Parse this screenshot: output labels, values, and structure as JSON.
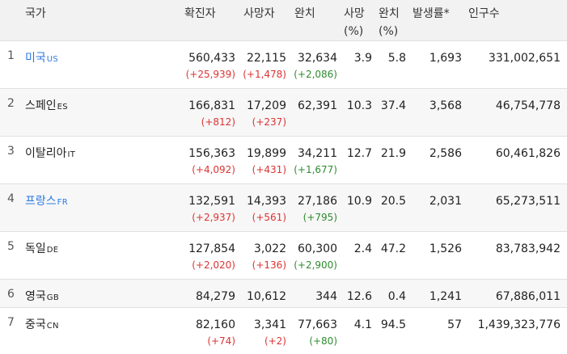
{
  "headers": {
    "country": "국가",
    "confirmed": "확진자",
    "deaths": "사망자",
    "recovered": "완치",
    "death_rate": "사망\n(%)",
    "recovery_rate": "완치\n(%)",
    "incidence": "발생률*",
    "population": "인구수"
  },
  "rows": [
    {
      "rank": "1",
      "name": "미국",
      "code": "US",
      "link": true,
      "confirmed": "560,433",
      "confirmed_delta": "(+25,939)",
      "deaths": "22,115",
      "deaths_delta": "(+1,478)",
      "recovered": "32,634",
      "recovered_delta": "(+2,086)",
      "death_rate": "3.9",
      "recovery_rate": "5.8",
      "incidence": "1,693",
      "population": "331,002,651"
    },
    {
      "rank": "2",
      "name": "스페인",
      "code": "ES",
      "link": false,
      "confirmed": "166,831",
      "confirmed_delta": "(+812)",
      "deaths": "17,209",
      "deaths_delta": "(+237)",
      "recovered": "62,391",
      "recovered_delta": "",
      "death_rate": "10.3",
      "recovery_rate": "37.4",
      "incidence": "3,568",
      "population": "46,754,778"
    },
    {
      "rank": "3",
      "name": "이탈리아",
      "code": "IT",
      "link": false,
      "confirmed": "156,363",
      "confirmed_delta": "(+4,092)",
      "deaths": "19,899",
      "deaths_delta": "(+431)",
      "recovered": "34,211",
      "recovered_delta": "(+1,677)",
      "death_rate": "12.7",
      "recovery_rate": "21.9",
      "incidence": "2,586",
      "population": "60,461,826"
    },
    {
      "rank": "4",
      "name": "프랑스",
      "code": "FR",
      "link": true,
      "confirmed": "132,591",
      "confirmed_delta": "(+2,937)",
      "deaths": "14,393",
      "deaths_delta": "(+561)",
      "recovered": "27,186",
      "recovered_delta": "(+795)",
      "death_rate": "10.9",
      "recovery_rate": "20.5",
      "incidence": "2,031",
      "population": "65,273,511"
    },
    {
      "rank": "5",
      "name": "독일",
      "code": "DE",
      "link": false,
      "confirmed": "127,854",
      "confirmed_delta": "(+2,020)",
      "deaths": "3,022",
      "deaths_delta": "(+136)",
      "recovered": "60,300",
      "recovered_delta": "(+2,900)",
      "death_rate": "2.4",
      "recovery_rate": "47.2",
      "incidence": "1,526",
      "population": "83,783,942"
    },
    {
      "rank": "6",
      "name": "영국",
      "code": "GB",
      "link": false,
      "confirmed": "84,279",
      "confirmed_delta": "",
      "deaths": "10,612",
      "deaths_delta": "",
      "recovered": "344",
      "recovered_delta": "",
      "death_rate": "12.6",
      "recovery_rate": "0.4",
      "incidence": "1,241",
      "population": "67,886,011"
    },
    {
      "rank": "7",
      "name": "중국",
      "code": "CN",
      "link": false,
      "confirmed": "82,160",
      "confirmed_delta": "(+74)",
      "deaths": "3,341",
      "deaths_delta": "(+2)",
      "recovered": "77,663",
      "recovered_delta": "(+80)",
      "death_rate": "4.1",
      "recovery_rate": "94.5",
      "incidence": "57",
      "population": "1,439,323,776"
    }
  ],
  "colors": {
    "link": "#2a7ae2",
    "increase": "#d33333",
    "recovered_increase": "#2e8b2e"
  }
}
